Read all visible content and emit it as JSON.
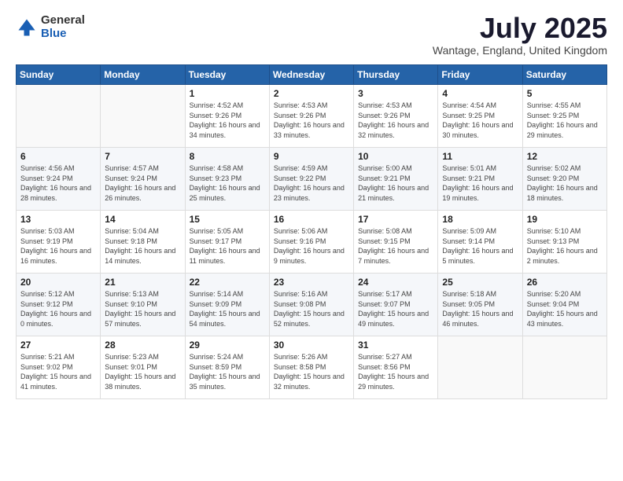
{
  "header": {
    "logo_general": "General",
    "logo_blue": "Blue",
    "month_title": "July 2025",
    "location": "Wantage, England, United Kingdom"
  },
  "days_of_week": [
    "Sunday",
    "Monday",
    "Tuesday",
    "Wednesday",
    "Thursday",
    "Friday",
    "Saturday"
  ],
  "weeks": [
    [
      {
        "day": "",
        "detail": ""
      },
      {
        "day": "",
        "detail": ""
      },
      {
        "day": "1",
        "detail": "Sunrise: 4:52 AM\nSunset: 9:26 PM\nDaylight: 16 hours and 34 minutes."
      },
      {
        "day": "2",
        "detail": "Sunrise: 4:53 AM\nSunset: 9:26 PM\nDaylight: 16 hours and 33 minutes."
      },
      {
        "day": "3",
        "detail": "Sunrise: 4:53 AM\nSunset: 9:26 PM\nDaylight: 16 hours and 32 minutes."
      },
      {
        "day": "4",
        "detail": "Sunrise: 4:54 AM\nSunset: 9:25 PM\nDaylight: 16 hours and 30 minutes."
      },
      {
        "day": "5",
        "detail": "Sunrise: 4:55 AM\nSunset: 9:25 PM\nDaylight: 16 hours and 29 minutes."
      }
    ],
    [
      {
        "day": "6",
        "detail": "Sunrise: 4:56 AM\nSunset: 9:24 PM\nDaylight: 16 hours and 28 minutes."
      },
      {
        "day": "7",
        "detail": "Sunrise: 4:57 AM\nSunset: 9:24 PM\nDaylight: 16 hours and 26 minutes."
      },
      {
        "day": "8",
        "detail": "Sunrise: 4:58 AM\nSunset: 9:23 PM\nDaylight: 16 hours and 25 minutes."
      },
      {
        "day": "9",
        "detail": "Sunrise: 4:59 AM\nSunset: 9:22 PM\nDaylight: 16 hours and 23 minutes."
      },
      {
        "day": "10",
        "detail": "Sunrise: 5:00 AM\nSunset: 9:21 PM\nDaylight: 16 hours and 21 minutes."
      },
      {
        "day": "11",
        "detail": "Sunrise: 5:01 AM\nSunset: 9:21 PM\nDaylight: 16 hours and 19 minutes."
      },
      {
        "day": "12",
        "detail": "Sunrise: 5:02 AM\nSunset: 9:20 PM\nDaylight: 16 hours and 18 minutes."
      }
    ],
    [
      {
        "day": "13",
        "detail": "Sunrise: 5:03 AM\nSunset: 9:19 PM\nDaylight: 16 hours and 16 minutes."
      },
      {
        "day": "14",
        "detail": "Sunrise: 5:04 AM\nSunset: 9:18 PM\nDaylight: 16 hours and 14 minutes."
      },
      {
        "day": "15",
        "detail": "Sunrise: 5:05 AM\nSunset: 9:17 PM\nDaylight: 16 hours and 11 minutes."
      },
      {
        "day": "16",
        "detail": "Sunrise: 5:06 AM\nSunset: 9:16 PM\nDaylight: 16 hours and 9 minutes."
      },
      {
        "day": "17",
        "detail": "Sunrise: 5:08 AM\nSunset: 9:15 PM\nDaylight: 16 hours and 7 minutes."
      },
      {
        "day": "18",
        "detail": "Sunrise: 5:09 AM\nSunset: 9:14 PM\nDaylight: 16 hours and 5 minutes."
      },
      {
        "day": "19",
        "detail": "Sunrise: 5:10 AM\nSunset: 9:13 PM\nDaylight: 16 hours and 2 minutes."
      }
    ],
    [
      {
        "day": "20",
        "detail": "Sunrise: 5:12 AM\nSunset: 9:12 PM\nDaylight: 16 hours and 0 minutes."
      },
      {
        "day": "21",
        "detail": "Sunrise: 5:13 AM\nSunset: 9:10 PM\nDaylight: 15 hours and 57 minutes."
      },
      {
        "day": "22",
        "detail": "Sunrise: 5:14 AM\nSunset: 9:09 PM\nDaylight: 15 hours and 54 minutes."
      },
      {
        "day": "23",
        "detail": "Sunrise: 5:16 AM\nSunset: 9:08 PM\nDaylight: 15 hours and 52 minutes."
      },
      {
        "day": "24",
        "detail": "Sunrise: 5:17 AM\nSunset: 9:07 PM\nDaylight: 15 hours and 49 minutes."
      },
      {
        "day": "25",
        "detail": "Sunrise: 5:18 AM\nSunset: 9:05 PM\nDaylight: 15 hours and 46 minutes."
      },
      {
        "day": "26",
        "detail": "Sunrise: 5:20 AM\nSunset: 9:04 PM\nDaylight: 15 hours and 43 minutes."
      }
    ],
    [
      {
        "day": "27",
        "detail": "Sunrise: 5:21 AM\nSunset: 9:02 PM\nDaylight: 15 hours and 41 minutes."
      },
      {
        "day": "28",
        "detail": "Sunrise: 5:23 AM\nSunset: 9:01 PM\nDaylight: 15 hours and 38 minutes."
      },
      {
        "day": "29",
        "detail": "Sunrise: 5:24 AM\nSunset: 8:59 PM\nDaylight: 15 hours and 35 minutes."
      },
      {
        "day": "30",
        "detail": "Sunrise: 5:26 AM\nSunset: 8:58 PM\nDaylight: 15 hours and 32 minutes."
      },
      {
        "day": "31",
        "detail": "Sunrise: 5:27 AM\nSunset: 8:56 PM\nDaylight: 15 hours and 29 minutes."
      },
      {
        "day": "",
        "detail": ""
      },
      {
        "day": "",
        "detail": ""
      }
    ]
  ]
}
